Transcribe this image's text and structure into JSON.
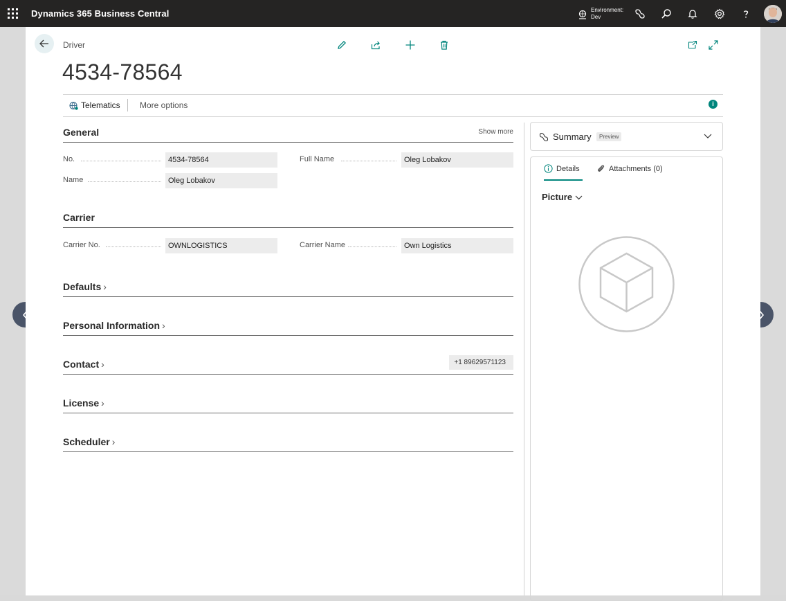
{
  "topbar": {
    "app_name": "Dynamics 365 Business Central",
    "environment_line1": "Environment:",
    "environment_line2": "Dev"
  },
  "breadcrumb": "Driver",
  "record_title": "4534-78564",
  "actionbar": {
    "telematics_label": "Telematics",
    "more_options_label": "More options"
  },
  "general": {
    "title": "General",
    "show_more": "Show more",
    "no_label": "No.",
    "no_value": "4534-78564",
    "name_label": "Name",
    "name_value": "Oleg Lobakov",
    "full_name_label": "Full Name",
    "full_name_value": "Oleg Lobakov"
  },
  "carrier": {
    "title": "Carrier",
    "carrier_no_label": "Carrier No.",
    "carrier_no_value": "OWNLOGISTICS",
    "carrier_name_label": "Carrier Name",
    "carrier_name_value": "Own Logistics"
  },
  "sections": {
    "defaults": "Defaults",
    "personal_information": "Personal Information",
    "contact": "Contact",
    "contact_phone": "+1 89629571123",
    "license": "License",
    "scheduler": "Scheduler"
  },
  "factbox": {
    "summary_title": "Summary",
    "summary_badge": "Preview",
    "tab_details": "Details",
    "tab_attachments": "Attachments (0)",
    "picture_title": "Picture"
  },
  "colors": {
    "accent": "#00857c",
    "topbar": "#252423",
    "nav_arrow": "#4a5468"
  }
}
